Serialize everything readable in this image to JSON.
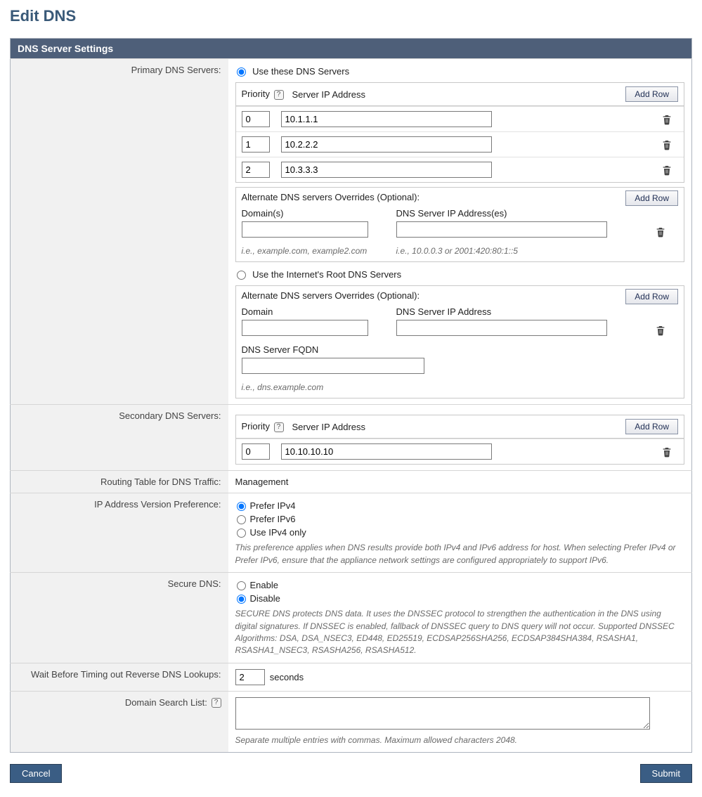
{
  "page": {
    "title": "Edit DNS"
  },
  "sectionHeader": "DNS Server Settings",
  "labels": {
    "primary": "Primary DNS Servers:",
    "secondary": "Secondary DNS Servers:",
    "routing": "Routing Table for DNS Traffic:",
    "ipPref": "IP Address Version Preference:",
    "secureDns": "Secure DNS:",
    "wait": "Wait Before Timing out Reverse DNS Lookups:",
    "searchList": "Domain Search List:"
  },
  "primary": {
    "options": {
      "useThese": "Use these DNS Servers",
      "useRoot": "Use the Internet's Root DNS Servers",
      "selected": "useThese"
    },
    "tableHeaders": {
      "priority": "Priority",
      "server": "Server IP Address",
      "addRow": "Add Row"
    },
    "rows": [
      {
        "priority": "0",
        "ip": "10.1.1.1"
      },
      {
        "priority": "1",
        "ip": "10.2.2.2"
      },
      {
        "priority": "2",
        "ip": "10.3.3.3"
      }
    ],
    "altTheseTitle": "Alternate DNS servers Overrides (Optional):",
    "altThese": {
      "headers": {
        "domains": "Domain(s)",
        "addresses": "DNS Server IP Address(es)"
      },
      "row": {
        "domains": "",
        "addresses": ""
      },
      "hintDomains": "i.e., example.com, example2.com",
      "hintAddresses": "i.e., 10.0.0.3 or 2001:420:80:1::5",
      "addRow": "Add Row"
    },
    "altRootTitle": "Alternate DNS servers Overrides (Optional):",
    "altRoot": {
      "headers": {
        "domain": "Domain",
        "ip": "DNS Server IP Address",
        "fqdn": "DNS Server FQDN"
      },
      "row": {
        "domain": "",
        "ip": "",
        "fqdn": ""
      },
      "hintFqdn": "i.e., dns.example.com",
      "addRow": "Add Row"
    }
  },
  "secondary": {
    "tableHeaders": {
      "priority": "Priority",
      "server": "Server IP Address",
      "addRow": "Add Row"
    },
    "rows": [
      {
        "priority": "0",
        "ip": "10.10.10.10"
      }
    ]
  },
  "routingValue": "Management",
  "ipPref": {
    "options": {
      "ipv4": "Prefer IPv4",
      "ipv6": "Prefer IPv6",
      "ipv4only": "Use IPv4 only"
    },
    "selected": "ipv4",
    "desc": "This preference applies when DNS results provide both IPv4 and IPv6 address for host. When selecting Prefer IPv4 or Prefer IPv6, ensure that the appliance network settings are configured appropriately to support IPv6."
  },
  "secureDns": {
    "options": {
      "enable": "Enable",
      "disable": "Disable"
    },
    "selected": "disable",
    "desc": "SECURE DNS protects DNS data. It uses the DNSSEC protocol to strengthen the authentication in the DNS using digital signatures. If DNSSEC is enabled, fallback of DNSSEC query to DNS query will not occur. Supported DNSSEC Algorithms: DSA, DSA_NSEC3, ED448, ED25519, ECDSAP256SHA256, ECDSAP384SHA384, RSASHA1, RSASHA1_NSEC3, RSASHA256, RSASHA512."
  },
  "wait": {
    "value": "2",
    "unit": "seconds"
  },
  "searchList": {
    "value": "",
    "hint": "Separate multiple entries with commas. Maximum allowed characters 2048."
  },
  "buttons": {
    "cancel": "Cancel",
    "submit": "Submit"
  },
  "qMark": "?"
}
